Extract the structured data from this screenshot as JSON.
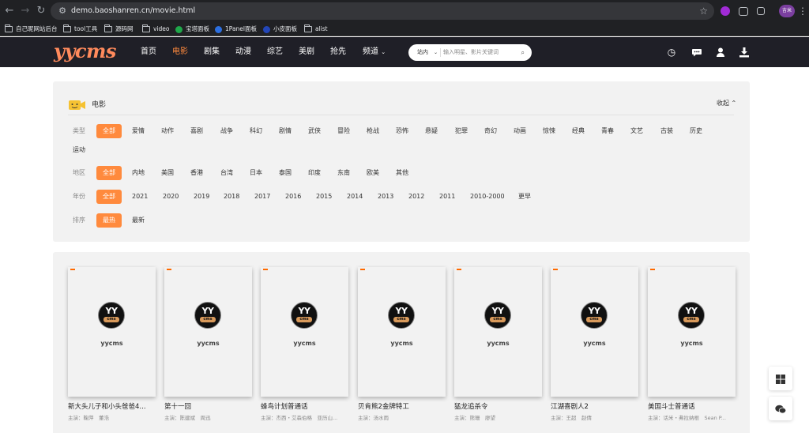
{
  "browser": {
    "url": "demo.baoshanren.cn/movie.html",
    "bookmarks": [
      "自己昵网站后台",
      "tool工具",
      "源码网",
      "video",
      "宝塔面板",
      "1Panel面板",
      "小皮面板",
      "alist"
    ],
    "profile_label": "吉米"
  },
  "site": {
    "logo": "yycms",
    "nav": [
      "首页",
      "电影",
      "剧集",
      "动漫",
      "综艺",
      "美剧",
      "抢先",
      "频道"
    ],
    "active_nav": "电影",
    "search": {
      "scope": "站内",
      "placeholder": "输入明星、影片关键词"
    }
  },
  "filters": {
    "title": "电影",
    "collapse_label": "收起",
    "rows": [
      {
        "label": "类型",
        "options": [
          "全部",
          "爱情",
          "动作",
          "喜剧",
          "战争",
          "科幻",
          "剧情",
          "武侠",
          "冒险",
          "枪战",
          "恐怖",
          "悬疑",
          "犯罪",
          "奇幻",
          "动画",
          "惊悚",
          "经典",
          "青春",
          "文艺",
          "古装",
          "历史",
          "运动"
        ],
        "selected": "全部"
      },
      {
        "label": "地区",
        "options": [
          "全部",
          "内地",
          "美国",
          "香港",
          "台湾",
          "日本",
          "泰国",
          "印度",
          "东南",
          "欧美",
          "其他"
        ],
        "selected": "全部"
      },
      {
        "label": "年份",
        "options": [
          "全部",
          "2021",
          "2020",
          "2019",
          "2018",
          "2017",
          "2016",
          "2015",
          "2014",
          "2013",
          "2012",
          "2011",
          "2010-2000",
          "更早"
        ],
        "selected": "全部"
      },
      {
        "label": "排序",
        "options": [
          "最热",
          "最新"
        ],
        "selected": "最热"
      }
    ]
  },
  "movies": [
    {
      "poster_brand": "yycms",
      "title": "新大头儿子和小头爸爸4...",
      "cast": "主演：鞠萍　董浩"
    },
    {
      "poster_brand": "yycms",
      "title": "第十一回",
      "cast": "主演：陈建斌　周迅"
    },
    {
      "poster_brand": "yycms",
      "title": "蜂鸟计划普通话",
      "cast": "主演：杰西・艾森伯格　亚历山..."
    },
    {
      "poster_brand": "yycms",
      "title": "贝肯熊2金牌特工",
      "cast": "主演：汤水雨"
    },
    {
      "poster_brand": "yycms",
      "title": "猛龙追杀令",
      "cast": "主演：熊珊　廖望"
    },
    {
      "poster_brand": "yycms",
      "title": "江湖喜剧人2",
      "cast": "主演：王超　赵倩"
    },
    {
      "poster_brand": "yycms",
      "title": "美国斗士普通话",
      "cast": "主演：话米・弗拉纳根　Sean P..."
    }
  ],
  "poster_logo": {
    "top": "YY",
    "bottom": "cms"
  }
}
